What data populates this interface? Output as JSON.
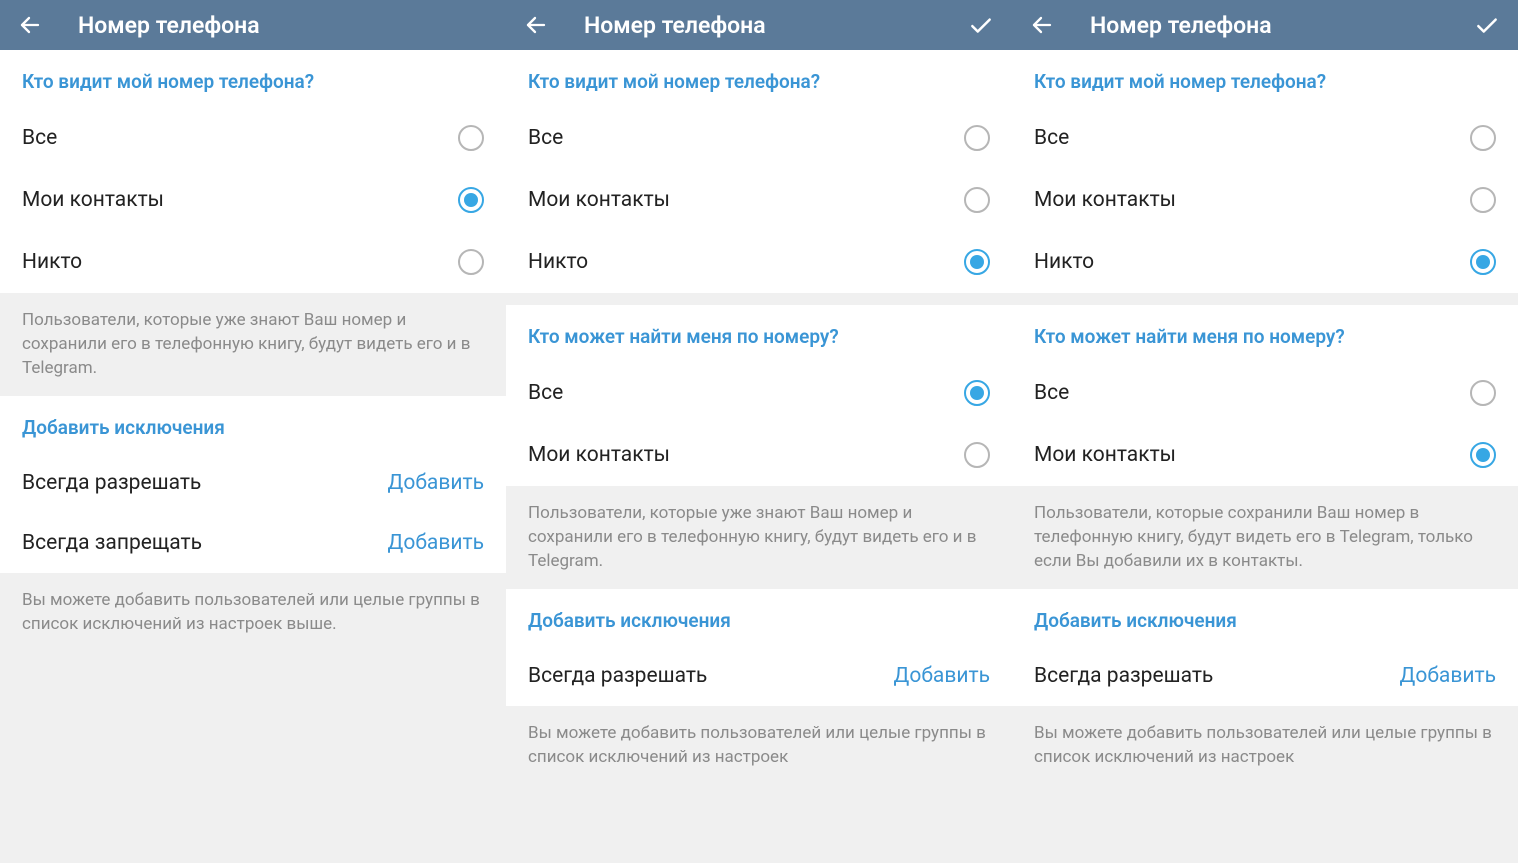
{
  "panels": [
    {
      "header": {
        "title": "Номер телефона",
        "showCheck": false
      },
      "sections": [
        {
          "title": "Кто видит мой номер телефона?",
          "options": [
            {
              "label": "Все",
              "selected": false
            },
            {
              "label": "Мои контакты",
              "selected": true
            },
            {
              "label": "Никто",
              "selected": false
            }
          ]
        }
      ],
      "info1": "Пользователи, которые уже знают Ваш номер и сохранили его в телефонную книгу, будут видеть его и в Telegram.",
      "exceptionsTitle": "Добавить исключения",
      "exceptions": [
        {
          "label": "Всегда разрешать",
          "action": "Добавить"
        },
        {
          "label": "Всегда запрещать",
          "action": "Добавить"
        }
      ],
      "info2": "Вы можете добавить пользователей или целые группы в список исключений из настроек выше."
    },
    {
      "header": {
        "title": "Номер телефона",
        "showCheck": true
      },
      "sections": [
        {
          "title": "Кто видит мой номер телефона?",
          "options": [
            {
              "label": "Все",
              "selected": false
            },
            {
              "label": "Мои контакты",
              "selected": false
            },
            {
              "label": "Никто",
              "selected": true
            }
          ]
        },
        {
          "title": "Кто может найти меня по номеру?",
          "options": [
            {
              "label": "Все",
              "selected": true
            },
            {
              "label": "Мои контакты",
              "selected": false
            }
          ]
        }
      ],
      "info1": "Пользователи, которые уже знают Ваш номер и сохранили его в телефонную книгу, будут видеть его и в Telegram.",
      "exceptionsTitle": "Добавить исключения",
      "exceptions": [
        {
          "label": "Всегда разрешать",
          "action": "Добавить"
        }
      ],
      "info2": "Вы можете добавить пользователей или целые группы в список исключений из настроек"
    },
    {
      "header": {
        "title": "Номер телефона",
        "showCheck": true
      },
      "sections": [
        {
          "title": "Кто видит мой номер телефона?",
          "options": [
            {
              "label": "Все",
              "selected": false
            },
            {
              "label": "Мои контакты",
              "selected": false
            },
            {
              "label": "Никто",
              "selected": true
            }
          ]
        },
        {
          "title": "Кто может найти меня по номеру?",
          "options": [
            {
              "label": "Все",
              "selected": false
            },
            {
              "label": "Мои контакты",
              "selected": true
            }
          ]
        }
      ],
      "info1": "Пользователи, которые сохранили Ваш номер в телефонную книгу, будут видеть его в Telegram, только если Вы добавили их в контакты.",
      "exceptionsTitle": "Добавить исключения",
      "exceptions": [
        {
          "label": "Всегда разрешать",
          "action": "Добавить"
        }
      ],
      "info2": "Вы можете добавить пользователей или целые группы в список исключений из настроек"
    }
  ]
}
